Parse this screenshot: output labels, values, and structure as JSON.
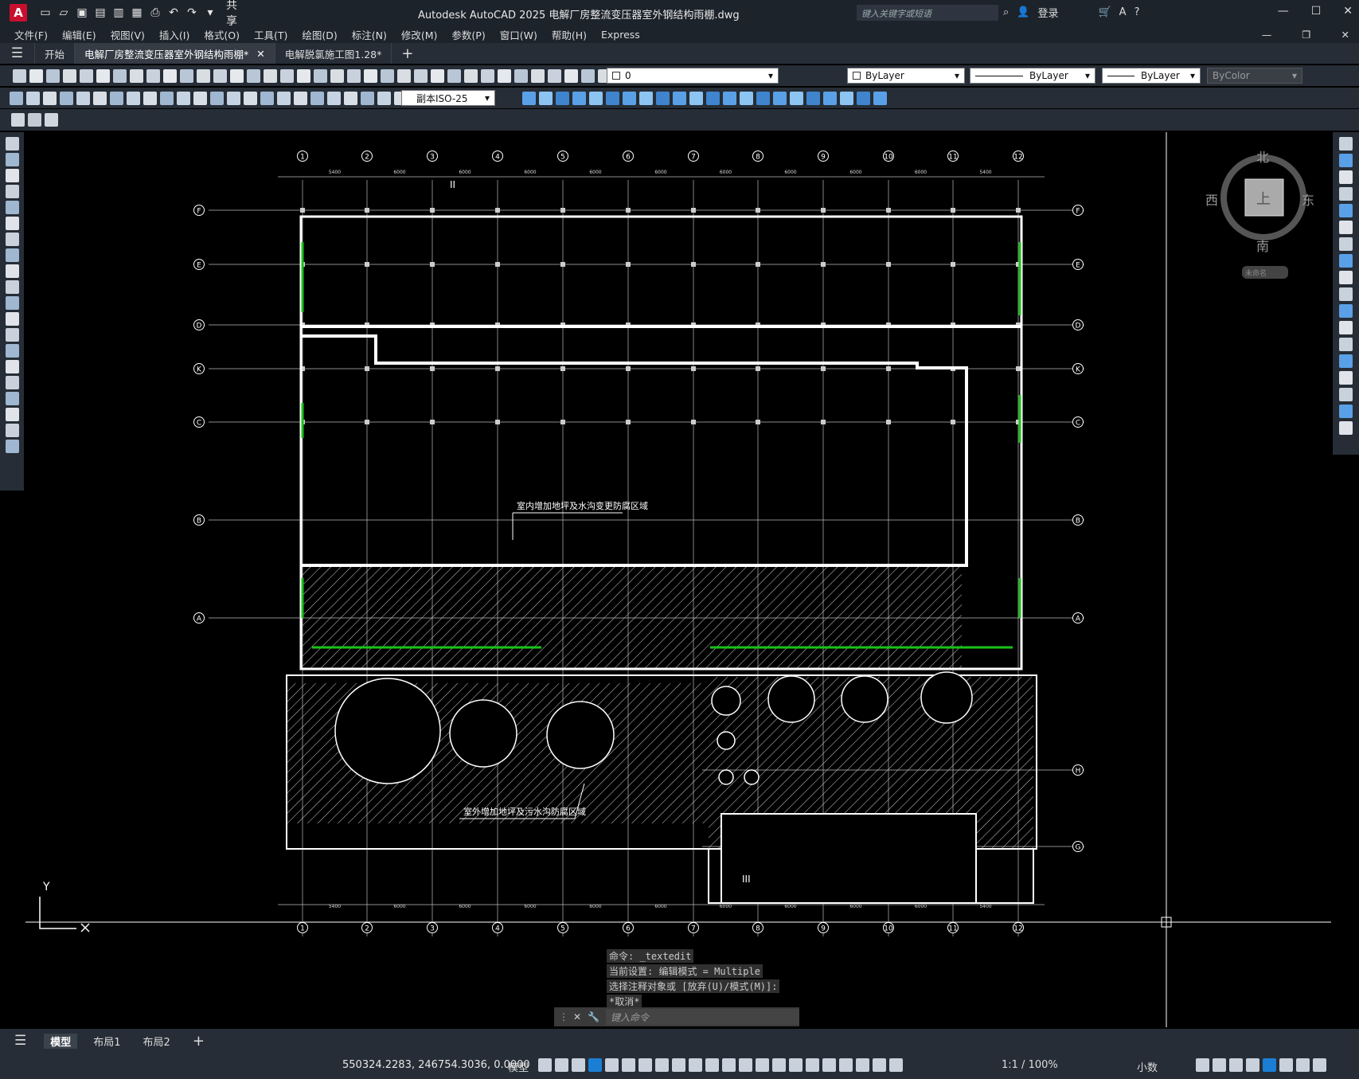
{
  "app": {
    "logo": "A",
    "title": "Autodesk AutoCAD 2025    电解厂房整流变压器室外钢结构雨棚.dwg",
    "share_label": "共享",
    "search_placeholder": "键入关键字或短语",
    "login_label": "登录"
  },
  "menu": [
    "文件(F)",
    "编辑(E)",
    "视图(V)",
    "插入(I)",
    "格式(O)",
    "工具(T)",
    "绘图(D)",
    "标注(N)",
    "修改(M)",
    "参数(P)",
    "窗口(W)",
    "帮助(H)",
    "Express"
  ],
  "tabs": [
    {
      "label": "开始"
    },
    {
      "label": "电解厂房整流变压器室外钢结构雨棚*"
    },
    {
      "label": "电解脱氯施工图1.28*"
    }
  ],
  "props": {
    "layer": "0",
    "dimstyle": "副本ISO-25",
    "color": "ByLayer",
    "linetype": "ByLayer",
    "lineweight": "ByLayer",
    "plotstyle": "ByColor"
  },
  "viewcube": {
    "north": "北",
    "south": "南",
    "east": "东",
    "west": "西",
    "top": "上",
    "wcs": "未命名"
  },
  "ucs": {
    "y": "Y"
  },
  "grid": {
    "cols": [
      "1",
      "2",
      "3",
      "4",
      "5",
      "6",
      "7",
      "8",
      "9",
      "10",
      "11",
      "12"
    ],
    "rows": [
      "F",
      "E",
      "D",
      "K",
      "C",
      "B",
      "A"
    ],
    "extra_rows": [
      "H",
      "G"
    ],
    "col_dims": [
      "5400",
      "6000",
      "6000",
      "6000",
      "6000",
      "6000",
      "6000",
      "6000",
      "6000",
      "6000",
      "5400"
    ]
  },
  "annotations": {
    "indoor": "室内增加地坪及水沟变更防腐区域",
    "outdoor": "室外增加地坪及污水沟防腐区域",
    "marker_bottom": "III",
    "marker_top": "II"
  },
  "command": {
    "history": [
      "命令: _textedit",
      "当前设置: 编辑模式 = Multiple",
      "选择注释对象或 [放弃(U)/模式(M)]:",
      "*取消*"
    ],
    "placeholder": "键入命令"
  },
  "layouts": [
    "模型",
    "布局1",
    "布局2"
  ],
  "status": {
    "coords": "550324.2283, 246754.3036, 0.0000",
    "space": "模型",
    "scale": "1:1 / 100%",
    "units": "小数"
  },
  "colors": {
    "accent": "#1a7fd4",
    "green": "#18c21a",
    "bg": "#000000"
  }
}
